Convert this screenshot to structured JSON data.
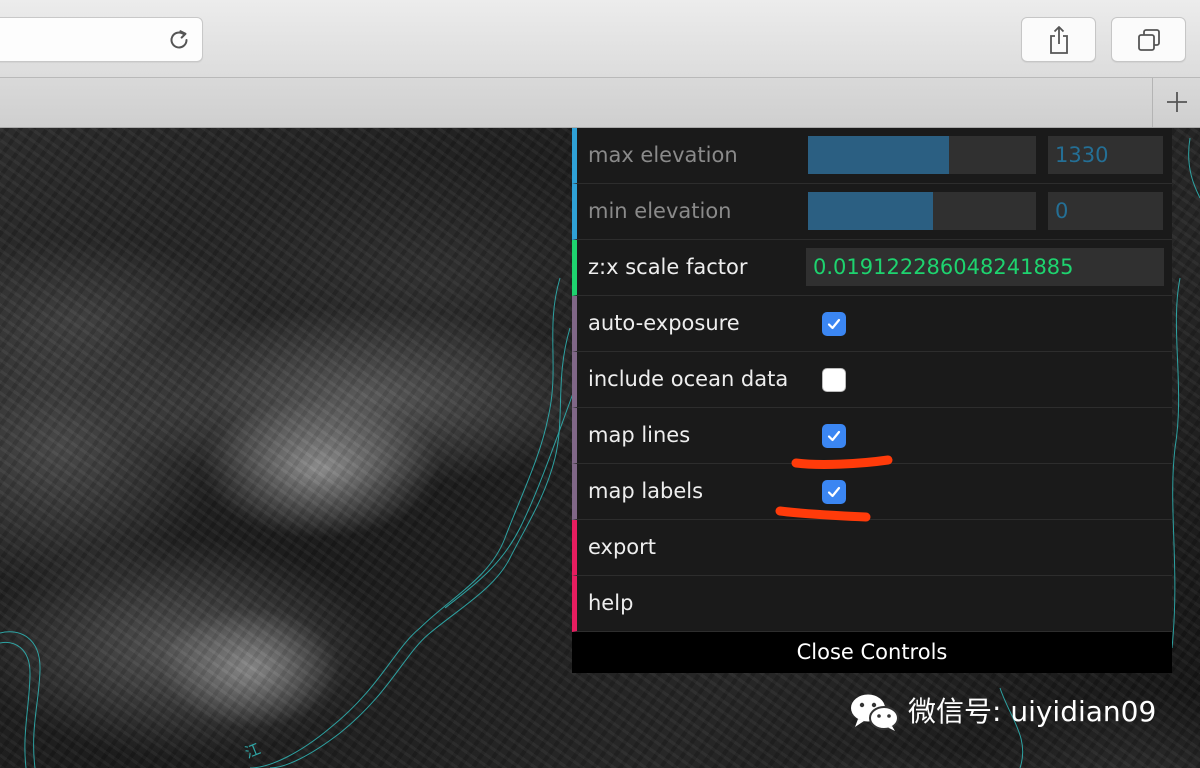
{
  "controls": {
    "max_elevation": {
      "label": "max elevation",
      "value": "1330",
      "fill_fraction": 0.62
    },
    "min_elevation": {
      "label": "min elevation",
      "value": "0",
      "fill_fraction": 0.55
    },
    "scale_factor": {
      "label": "z:x scale factor",
      "value": "0.019122286048241885"
    },
    "auto_exposure": {
      "label": "auto-exposure",
      "checked": true
    },
    "include_ocean": {
      "label": "include ocean data",
      "checked": false
    },
    "map_lines": {
      "label": "map lines",
      "checked": true
    },
    "map_labels": {
      "label": "map labels",
      "checked": true
    },
    "export": {
      "label": "export"
    },
    "help": {
      "label": "help"
    },
    "close": {
      "label": "Close Controls"
    }
  },
  "map": {
    "label_text": "江"
  },
  "watermark": {
    "text": "微信号: uiyidian09"
  },
  "icons": {
    "reload": "reload-icon",
    "share": "share-icon",
    "tabs": "tabs-icon",
    "new_tab": "plus-icon",
    "check": "checkmark-icon",
    "wechat": "wechat-icon"
  },
  "colors": {
    "number_accent": "#2fa1d6",
    "string_accent": "#1ed36f",
    "bool_accent": "#806787",
    "function_accent": "#e61d5f",
    "checkbox_on": "#3b86f2",
    "annotation": "#ff3b0a",
    "map_line": "#2fb8b8"
  }
}
